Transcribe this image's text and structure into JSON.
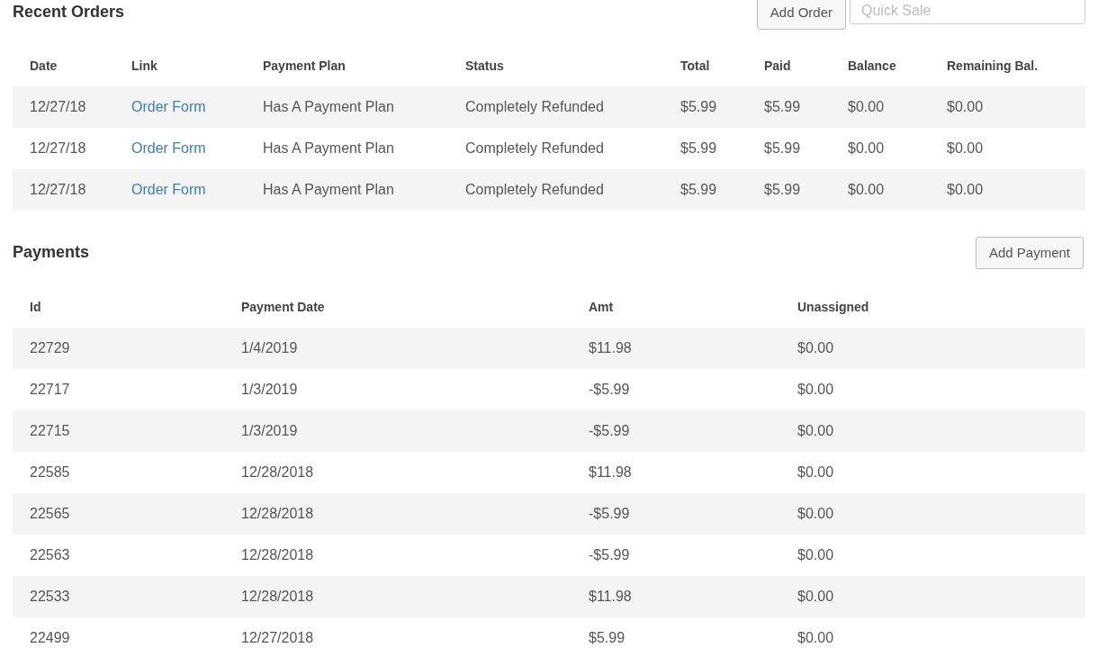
{
  "recent_orders": {
    "title": "Recent Orders",
    "add_button": "Add Order",
    "quick_sale": {
      "placeholder": "Quick Sale"
    },
    "columns": [
      "Date",
      "Link",
      "Payment Plan",
      "Status",
      "Total",
      "Paid",
      "Balance",
      "Remaining Bal."
    ],
    "rows": [
      {
        "date": "12/27/18",
        "link": "Order Form",
        "payment_plan": "Has A Payment Plan",
        "status": "Completely Refunded",
        "total": "$5.99",
        "paid": "$5.99",
        "balance": "$0.00",
        "remaining_bal": "$0.00"
      },
      {
        "date": "12/27/18",
        "link": "Order Form",
        "payment_plan": "Has A Payment Plan",
        "status": "Completely Refunded",
        "total": "$5.99",
        "paid": "$5.99",
        "balance": "$0.00",
        "remaining_bal": "$0.00"
      },
      {
        "date": "12/27/18",
        "link": "Order Form",
        "payment_plan": "Has A Payment Plan",
        "status": "Completely Refunded",
        "total": "$5.99",
        "paid": "$5.99",
        "balance": "$0.00",
        "remaining_bal": "$0.00"
      }
    ]
  },
  "payments": {
    "title": "Payments",
    "add_button": "Add Payment",
    "columns": [
      "Id",
      "Payment Date",
      "Amt",
      "Unassigned"
    ],
    "rows": [
      {
        "id": "22729",
        "payment_date": "1/4/2019",
        "amt": "$11.98",
        "unassigned": "$0.00"
      },
      {
        "id": "22717",
        "payment_date": "1/3/2019",
        "amt": "-$5.99",
        "unassigned": "$0.00"
      },
      {
        "id": "22715",
        "payment_date": "1/3/2019",
        "amt": "-$5.99",
        "unassigned": "$0.00"
      },
      {
        "id": "22585",
        "payment_date": "12/28/2018",
        "amt": "$11.98",
        "unassigned": "$0.00"
      },
      {
        "id": "22565",
        "payment_date": "12/28/2018",
        "amt": "-$5.99",
        "unassigned": "$0.00"
      },
      {
        "id": "22563",
        "payment_date": "12/28/2018",
        "amt": "-$5.99",
        "unassigned": "$0.00"
      },
      {
        "id": "22533",
        "payment_date": "12/28/2018",
        "amt": "$11.98",
        "unassigned": "$0.00"
      },
      {
        "id": "22499",
        "payment_date": "12/27/2018",
        "amt": "$5.99",
        "unassigned": "$0.00"
      }
    ]
  }
}
